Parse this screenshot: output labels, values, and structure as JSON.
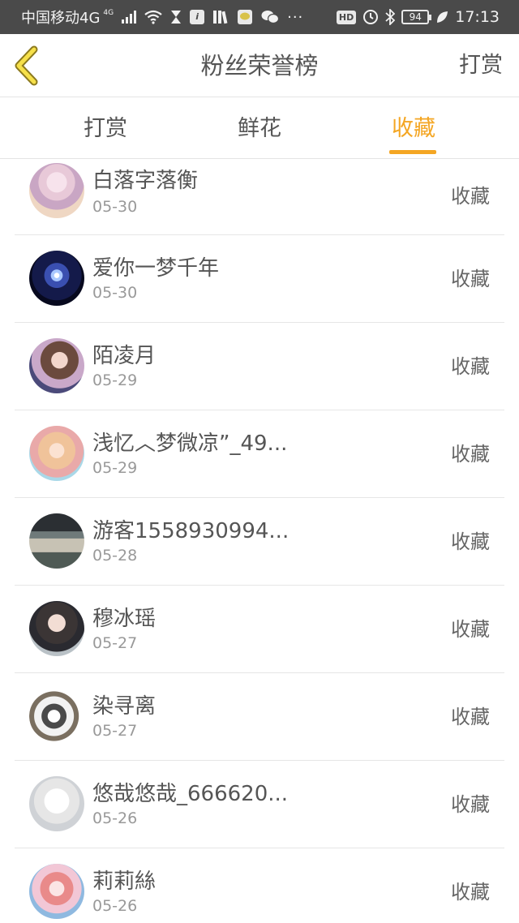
{
  "status_bar": {
    "carrier": "中国移动4G",
    "net_sup": "4G",
    "hd": "HD",
    "battery": "94",
    "time": "17:13",
    "icons": [
      "signal-icon",
      "wifi-icon",
      "hourglass-icon",
      "info-app-icon",
      "books-app-icon",
      "chat-app-icon",
      "wechat-icon",
      "more-dots-icon",
      "hd-icon",
      "alarm-icon",
      "bluetooth-icon",
      "battery-icon",
      "leaf-icon"
    ]
  },
  "header": {
    "title": "粉丝荣誉榜",
    "action": "打赏"
  },
  "tabs": [
    {
      "label": "打赏"
    },
    {
      "label": "鲜花"
    },
    {
      "label": "收藏"
    }
  ],
  "active_tab": "收藏",
  "accent_color": "#f4a623",
  "fans": [
    {
      "name": "白落字落衡",
      "date": "05-30",
      "type": "收藏"
    },
    {
      "name": "爱你一梦千年",
      "date": "05-30",
      "type": "收藏"
    },
    {
      "name": "陌凌月",
      "date": "05-29",
      "type": "收藏"
    },
    {
      "name": "浅忆︿梦微凉”_49...",
      "date": "05-29",
      "type": "收藏"
    },
    {
      "name": "游客1558930994...",
      "date": "05-28",
      "type": "收藏"
    },
    {
      "name": "穆冰瑶",
      "date": "05-27",
      "type": "收藏"
    },
    {
      "name": "染寻离",
      "date": "05-27",
      "type": "收藏"
    },
    {
      "name": "悠哉悠哉_666620...",
      "date": "05-26",
      "type": "收藏"
    },
    {
      "name": "莉莉絲",
      "date": "05-26",
      "type": "收藏"
    }
  ]
}
